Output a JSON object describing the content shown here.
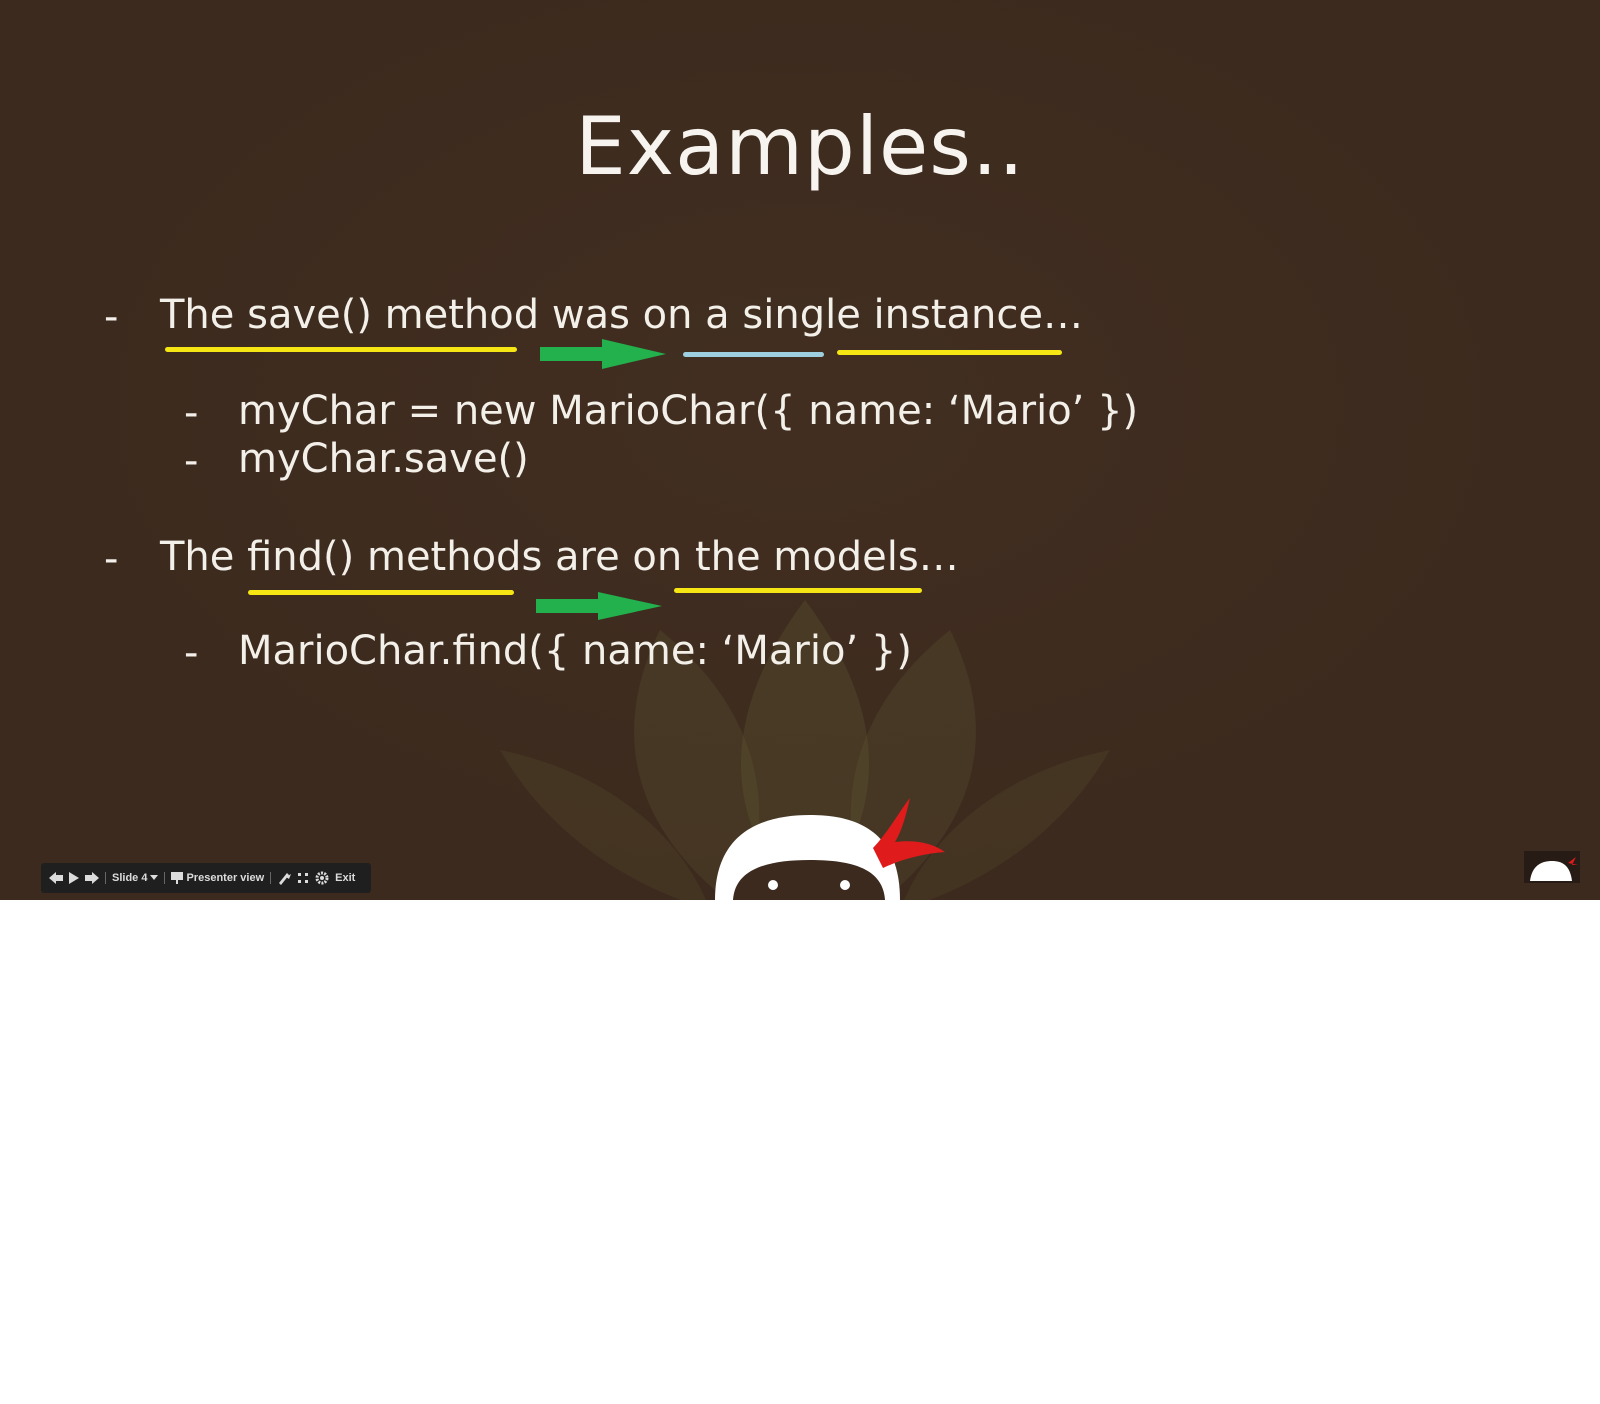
{
  "slide": {
    "title": "Examples..",
    "bullets": [
      {
        "dash": "-",
        "text": "The save() method was on a single instance…"
      },
      {
        "dash": "-",
        "text": "myChar = new MarioChar({ name: ‘Mario’ })"
      },
      {
        "dash": "-",
        "text": "myChar.save()"
      },
      {
        "dash": "-",
        "text": "The find() methods are on the models…"
      },
      {
        "dash": "-",
        "text": "MarioChar.find({ name: ‘Mario’ })"
      }
    ],
    "colors": {
      "background": "#3c2a1e",
      "underline_yellow": "#f5e614",
      "underline_blue": "#9ecfe0",
      "arrow_green": "#22b14c"
    }
  },
  "toolbar": {
    "prev_icon": "arrow-left-icon",
    "play_icon": "play-icon",
    "next_icon": "arrow-right-icon",
    "slide_label": "Slide 4",
    "presenter_label": "Presenter view",
    "laser_icon": "laser-pointer-icon",
    "fullscreen_icon": "fullscreen-icon",
    "settings_icon": "gear-icon",
    "exit_label": "Exit"
  }
}
